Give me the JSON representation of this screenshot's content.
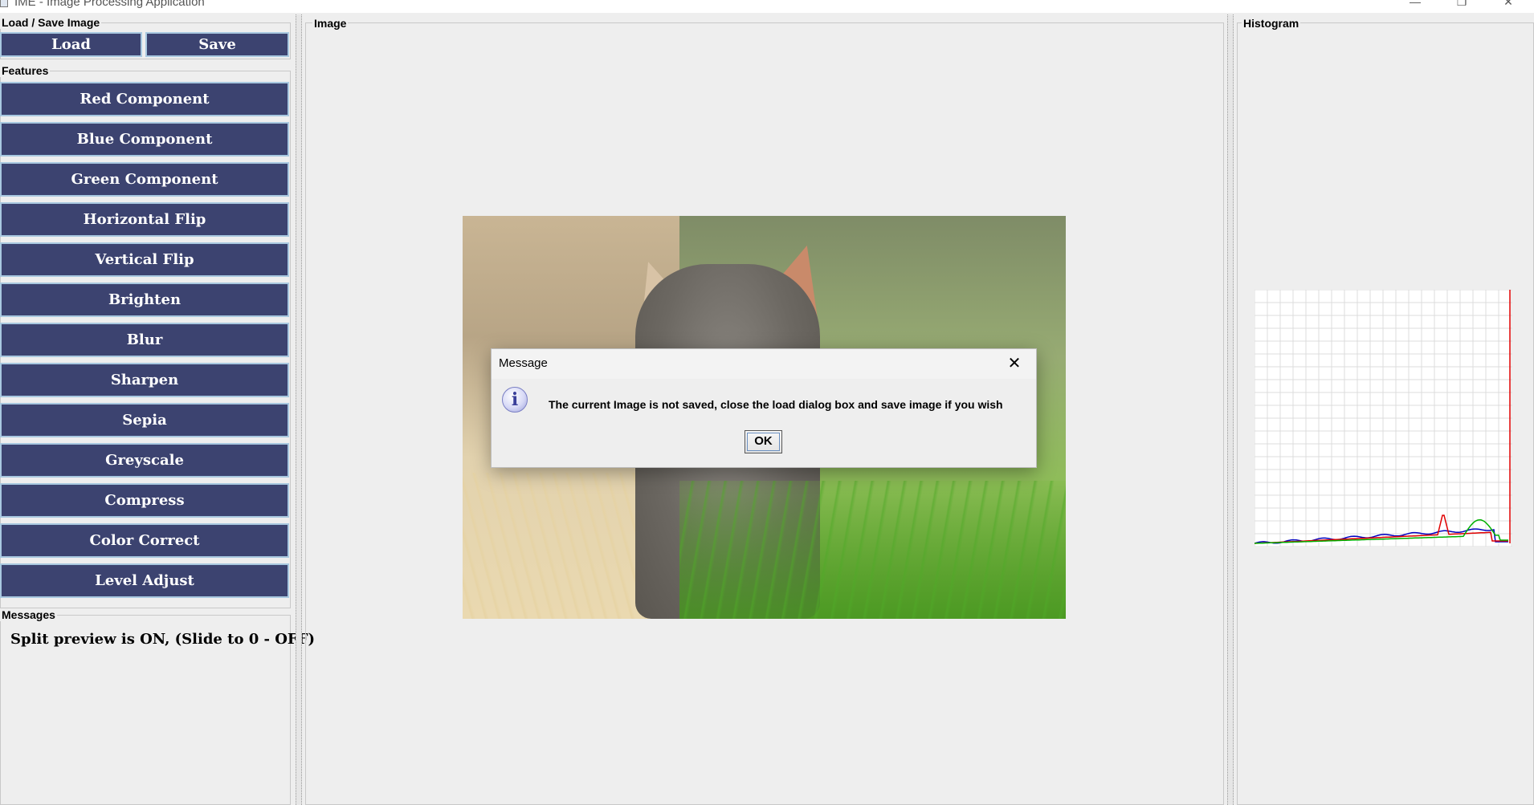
{
  "window": {
    "title": "IME - Image Processing Application",
    "controls": {
      "minimize": "—",
      "maximize": "❐",
      "close": "✕"
    }
  },
  "sidebar": {
    "load_save_title": "Load / Save Image",
    "load_label": "Load",
    "save_label": "Save",
    "features_title": "Features",
    "features": [
      "Red Component",
      "Blue Component",
      "Green Component",
      "Horizontal Flip",
      "Vertical Flip",
      "Brighten",
      "Blur",
      "Sharpen",
      "Sepia",
      "Greyscale",
      "Compress",
      "Color Correct",
      "Level Adjust"
    ],
    "messages_title": "Messages",
    "message_text": "Split preview is ON, (Slide to 0 - OFF)"
  },
  "image_panel": {
    "title": "Image"
  },
  "histogram_panel": {
    "title": "Histogram"
  },
  "dialog": {
    "title": "Message",
    "icon": "info-icon",
    "icon_glyph": "i",
    "close_glyph": "✕",
    "message": "The current Image is not saved, close the load dialog box and save image if you wish",
    "ok_label": "OK"
  },
  "colors": {
    "button_bg": "#3c4370",
    "button_border": "#a8c8e0",
    "histogram_red": "#e00000",
    "histogram_green": "#00b000",
    "histogram_blue": "#0000c0"
  }
}
